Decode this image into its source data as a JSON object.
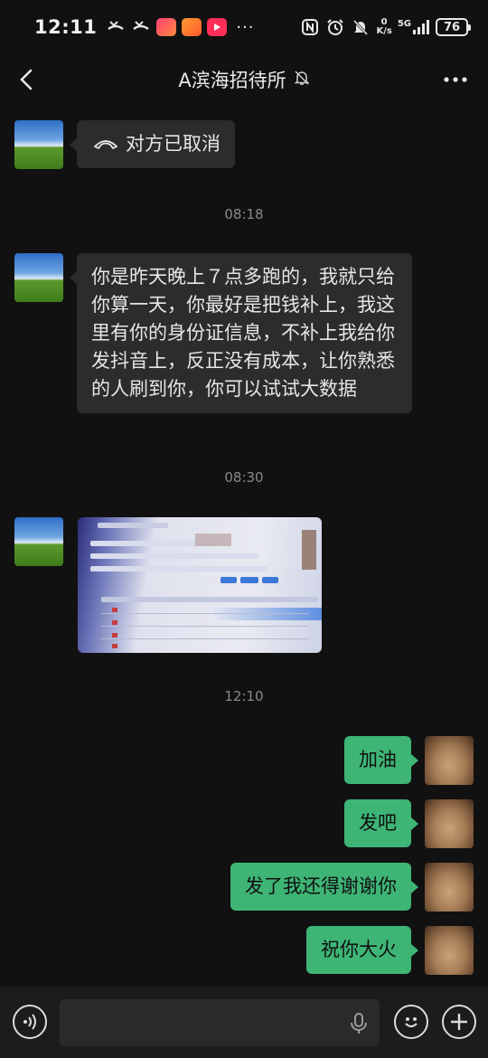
{
  "status_bar": {
    "time": "12:11",
    "more_indicator": "···",
    "net_speed_value": "0",
    "net_speed_unit": "K/s",
    "signal_label": "5G",
    "battery": "76"
  },
  "header": {
    "title": "A滨海招待所",
    "muted_icon": "bell-off-icon",
    "more_label": "•••"
  },
  "messages": {
    "call_cancelled": "对方已取消",
    "time_1": "08:18",
    "long_text": "你是昨天晚上７点多跑的，我就只给你算一天，你最好是把钱补上，我这里有你的身份证信息，不补上我给你发抖音上，反正没有成本，让你熟悉的人刷到你，你可以试试大数据",
    "time_2": "08:30",
    "time_3": "12:10",
    "out_1": "加油",
    "out_2": "发吧",
    "out_3": "发了我还得谢谢你",
    "out_4": "祝你大火"
  },
  "input": {
    "value": "",
    "placeholder": ""
  },
  "colors": {
    "background": "#111111",
    "incoming_bubble": "#2c2c2c",
    "outgoing_bubble": "#3eb575",
    "timestamp": "#8a8a8a"
  }
}
